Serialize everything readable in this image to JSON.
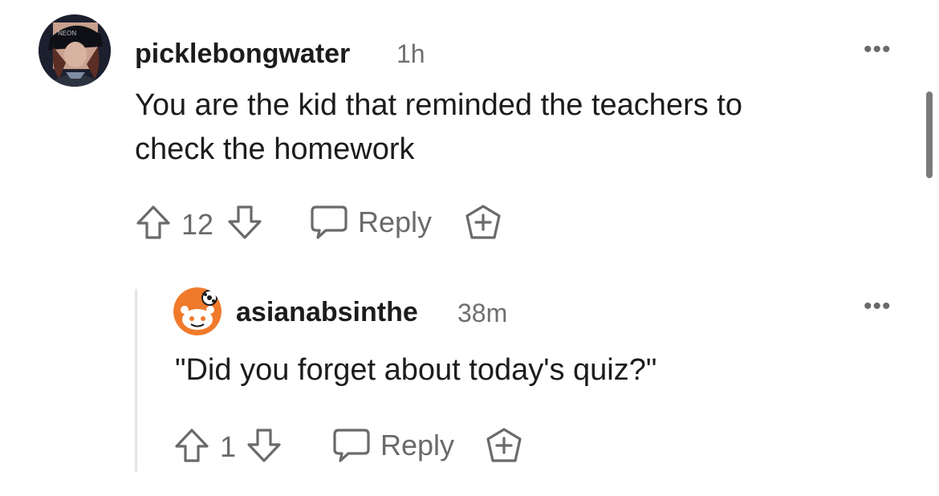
{
  "comments": [
    {
      "username": "picklebongwater",
      "time": "1h",
      "body_lines": [
        "You are the kid that reminded the teachers to",
        "check the homework"
      ],
      "score": "12",
      "reply_label": "Reply"
    },
    {
      "username": "asianabsinthe",
      "time": "38m",
      "body_lines": [
        "\"Did you forget about today's quiz?\""
      ],
      "score": "1",
      "reply_label": "Reply"
    }
  ],
  "colors": {
    "text": "#1c1c1c",
    "muted": "#6a6a6a",
    "avatar_orange": "#f07a2b",
    "thread_line": "#e4e4e4"
  },
  "icons": [
    "upvote-icon",
    "downvote-icon",
    "comment-bubble-icon",
    "award-icon",
    "more-options-icon"
  ]
}
